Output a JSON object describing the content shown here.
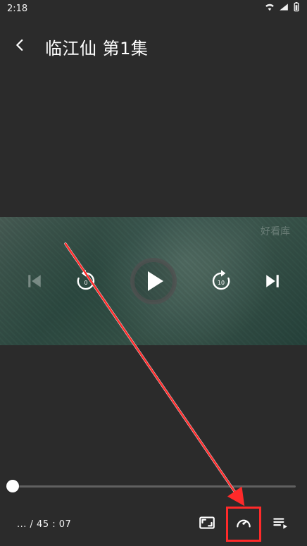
{
  "status_bar": {
    "time": "2:18"
  },
  "header": {
    "title": "临江仙 第1集"
  },
  "video": {
    "watermark": "好看库"
  },
  "controls": {
    "rewind_seconds": "0",
    "forward_seconds": "10"
  },
  "player": {
    "time_text": "... / 45 : 07",
    "progress_fraction": 0.0
  },
  "colors": {
    "accent_red": "#ff2a2a",
    "background": "#2b2b2b"
  },
  "icons": {
    "back": "chevron-left-icon",
    "prev": "skip-previous-icon",
    "rewind": "rewind-icon",
    "play": "play-icon",
    "forward": "fast-forward-icon",
    "next": "skip-next-icon",
    "fullscreen": "fullscreen-icon",
    "speed": "speedometer-icon",
    "playlist": "playlist-icon"
  }
}
